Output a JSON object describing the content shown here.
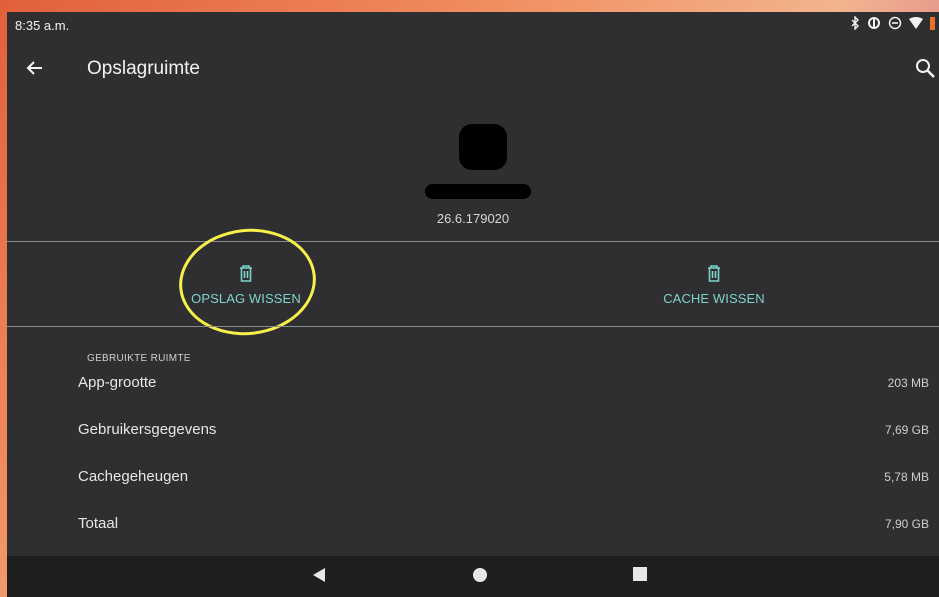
{
  "status_bar": {
    "time": "8:35 a.m.",
    "icons": [
      "bluetooth-icon",
      "data-saver-icon",
      "do-not-disturb-icon",
      "wifi-icon",
      "battery-icon"
    ]
  },
  "app_bar": {
    "title": "Opslagruimte",
    "back_icon": "arrow-back-icon",
    "search_icon": "search-icon"
  },
  "app_info": {
    "version": "26.6.179020"
  },
  "actions": {
    "clear_storage_label": "OPSLAG WISSEN",
    "clear_cache_label": "CACHE WISSEN",
    "icon": "trash-icon"
  },
  "storage": {
    "section_title": "GEBRUIKTE RUIMTE",
    "rows": [
      {
        "label": "App-grootte",
        "value": "203 MB"
      },
      {
        "label": "Gebruikersgegevens",
        "value": "7,69 GB"
      },
      {
        "label": "Cachegeheugen",
        "value": "5,78 MB"
      },
      {
        "label": "Totaal",
        "value": "7,90 GB"
      }
    ]
  },
  "colors": {
    "background": "#2f2f31",
    "accent": "#7fd3cc",
    "highlight": "#f6f04a",
    "nav_bar": "#1f1f1f"
  }
}
